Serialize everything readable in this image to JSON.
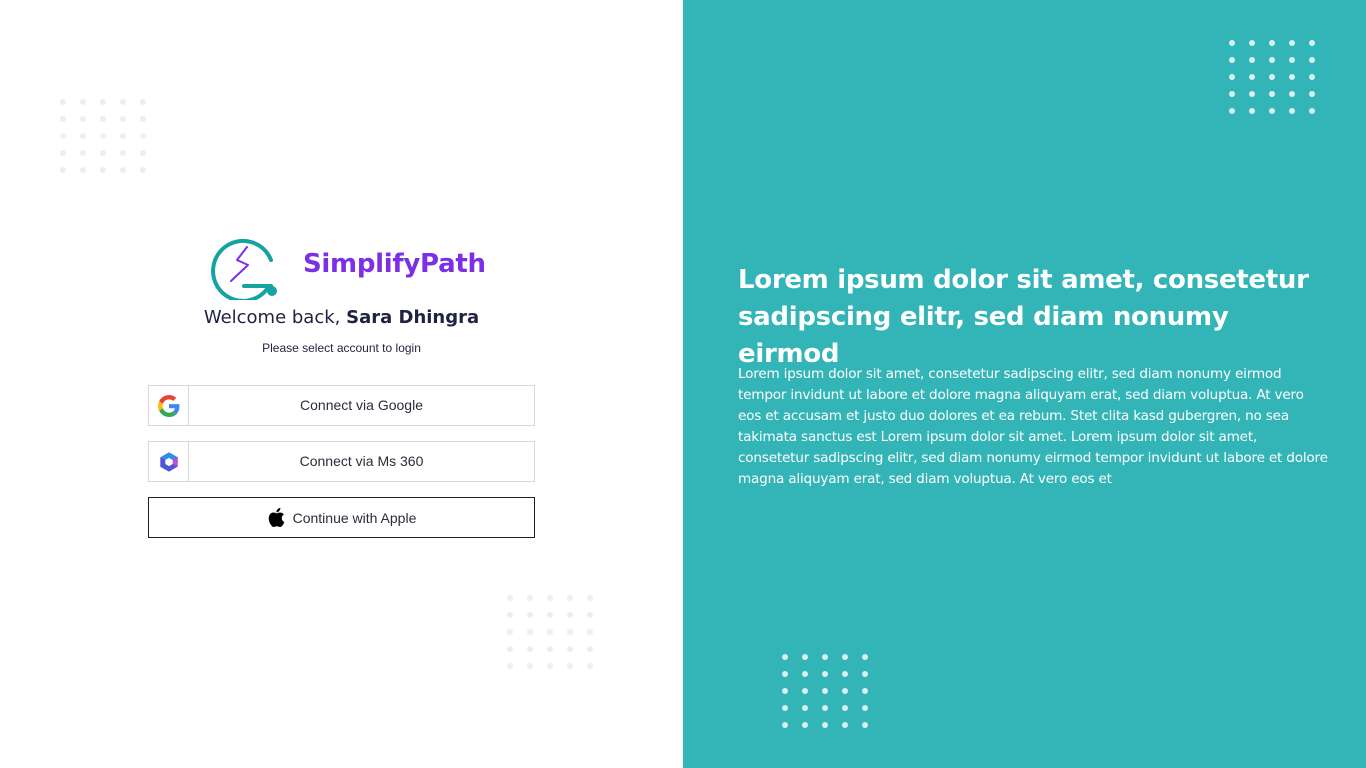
{
  "brand": {
    "name": "SimplifyPath",
    "color": "#7b2fe6",
    "logo_icon": "simplifypath-logo-icon",
    "logo_colors": {
      "ring": "#14a3a0",
      "bolt": "#7b2fe6"
    }
  },
  "login": {
    "welcome_prefix": "Welcome back, ",
    "user_name": "Sara Dhingra",
    "subtitle": "Please select account to login",
    "buttons": [
      {
        "label": "Connect via Google",
        "icon": "google-icon"
      },
      {
        "label": "Connect via Ms 360",
        "icon": "microsoft-365-icon"
      },
      {
        "label": "Continue with Apple",
        "icon": "apple-icon"
      }
    ]
  },
  "promo": {
    "headline": "Lorem ipsum dolor sit amet, consetetur sadipscing elitr, sed diam nonumy eirmod",
    "body": "Lorem ipsum dolor sit amet, consetetur sadipscing elitr, sed diam nonumy eirmod tempor invidunt ut labore et dolore magna aliquyam erat, sed diam voluptua. At vero eos et accusam et justo duo dolores et ea rebum. Stet clita kasd gubergren, no sea takimata sanctus est Lorem ipsum dolor sit amet. Lorem ipsum dolor sit amet, consetetur sadipscing elitr, sed diam nonumy eirmod tempor invidunt ut labore et dolore magna aliquyam erat, sed diam voluptua. At vero eos et"
  },
  "colors": {
    "panel_bg": "#33b5b8",
    "text_dark": "#1f2240",
    "button_border": "#d6d8dc"
  }
}
